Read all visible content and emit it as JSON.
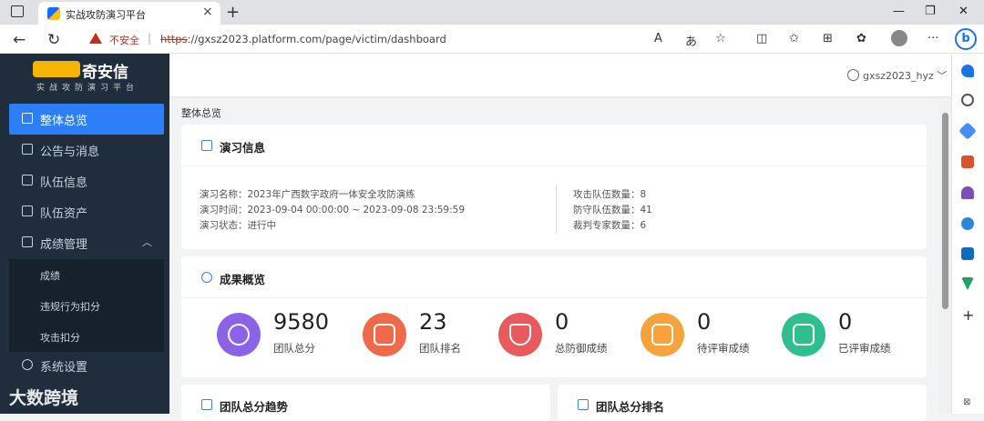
{
  "browser": {
    "tab_title": "实战攻防演习平台",
    "warning_label": "不安全",
    "url_protocol": "https",
    "url_rest": "://gxsz2023.platform.com/page/victim/dashboard"
  },
  "sidebar": {
    "brand_name": "奇安信",
    "brand_sub": "实战攻防演习平台",
    "items": [
      {
        "label": "整体总览"
      },
      {
        "label": "公告与消息"
      },
      {
        "label": "队伍信息"
      },
      {
        "label": "队伍资产"
      },
      {
        "label": "成绩管理"
      },
      {
        "label": "系统设置"
      }
    ],
    "subitems": [
      {
        "label": "成绩"
      },
      {
        "label": "违规行为扣分"
      },
      {
        "label": "攻击扣分"
      }
    ],
    "watermark": "大数跨境"
  },
  "header": {
    "username": "gxsz2023_hyz"
  },
  "breadcrumb": "整体总览",
  "exercise": {
    "title": "演习信息",
    "name_label": "演习名称：",
    "name_value": "2023年广西数字政府一体安全攻防演练",
    "time_label": "演习时间：",
    "time_value": "2023-09-04 00:00:00 ~ 2023-09-08 23:59:59",
    "status_label": "演习状态：",
    "status_value": "进行中",
    "attack_label": "攻击队伍数量：",
    "attack_value": "8",
    "defense_label": "防守队伍数量：",
    "defense_value": "41",
    "judge_label": "裁判专家数量：",
    "judge_value": "6"
  },
  "results": {
    "title": "成果概览",
    "stats": [
      {
        "value": "9580",
        "label": "团队总分",
        "color": "#8a63e8"
      },
      {
        "value": "23",
        "label": "团队排名",
        "color": "#ef6a4b"
      },
      {
        "value": "0",
        "label": "总防御成绩",
        "color": "#e85a5e"
      },
      {
        "value": "0",
        "label": "待评审成绩",
        "color": "#f6a33d"
      },
      {
        "value": "0",
        "label": "已评审成绩",
        "color": "#2fbf8f"
      }
    ]
  },
  "bottom_cards": {
    "trend_title": "团队总分趋势",
    "rank_title": "团队总分排名"
  }
}
